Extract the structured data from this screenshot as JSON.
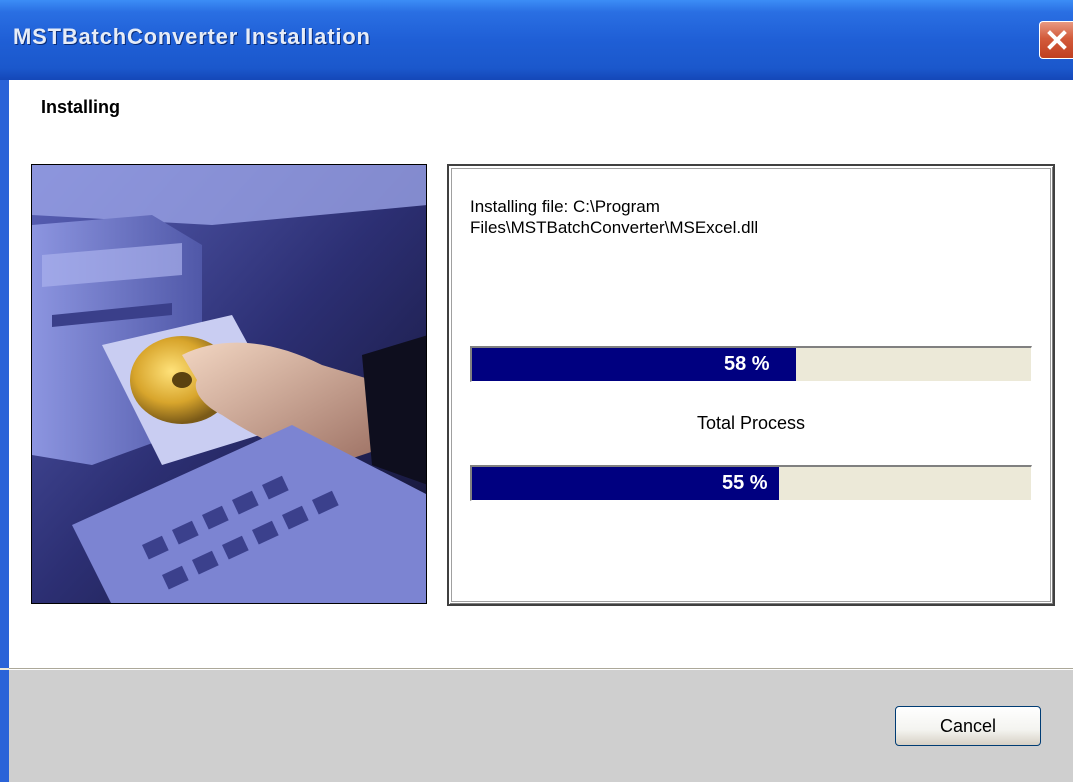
{
  "window": {
    "title": "MSTBatchConverter Installation",
    "close_icon": "close-icon"
  },
  "header": {
    "heading": "Installing"
  },
  "status": {
    "file_line1": "Installing file: C:\\Program",
    "file_line2": "Files\\MSTBatchConverter\\MSExcel.dll"
  },
  "file_progress": {
    "percent": 58,
    "label": "58 %"
  },
  "total_progress": {
    "title": "Total Process",
    "percent": 55,
    "label": "55 %"
  },
  "footer": {
    "cancel_label": "Cancel"
  },
  "colors": {
    "progress_fill": "#000080",
    "title_bar": "#1f5fd6",
    "close_button": "#d35b3b"
  }
}
